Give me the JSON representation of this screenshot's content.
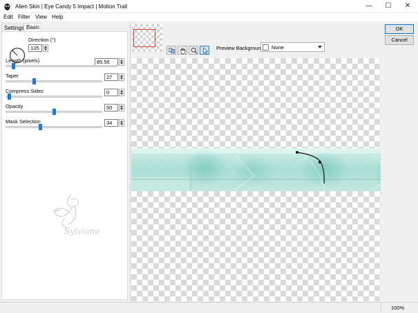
{
  "window": {
    "title": "Alien Skin | Eye Candy 5 Impact | Motion Trail"
  },
  "menu": [
    "Edit",
    "Filter",
    "View",
    "Help"
  ],
  "tabs": [
    "Settings",
    "Basic"
  ],
  "controls": {
    "direction": {
      "label": "Direction (°)",
      "value": "135"
    },
    "length": {
      "label": "Length (pixels)",
      "value": "85.56",
      "fraction": 0.07
    },
    "taper": {
      "label": "Taper",
      "value": "27",
      "fraction": 0.27
    },
    "compress_sides": {
      "label": "Compress Sides",
      "value": "0",
      "fraction": 0.0
    },
    "opacity": {
      "label": "Opacity",
      "value": "50",
      "fraction": 0.5
    },
    "mask_selection": {
      "label": "Mask Selection",
      "value": "34",
      "fraction": 0.34
    }
  },
  "preview": {
    "background_label": "Preview Background:",
    "background_value": "None"
  },
  "buttons": {
    "ok": "OK",
    "cancel": "Cancel"
  },
  "status": {
    "zoom": "100%"
  },
  "watermark_text": "Sylviane",
  "colors": {
    "accent": "#1f7ad1",
    "trail": "#a8ddd3",
    "thumb_frame": "#e23a2a"
  }
}
